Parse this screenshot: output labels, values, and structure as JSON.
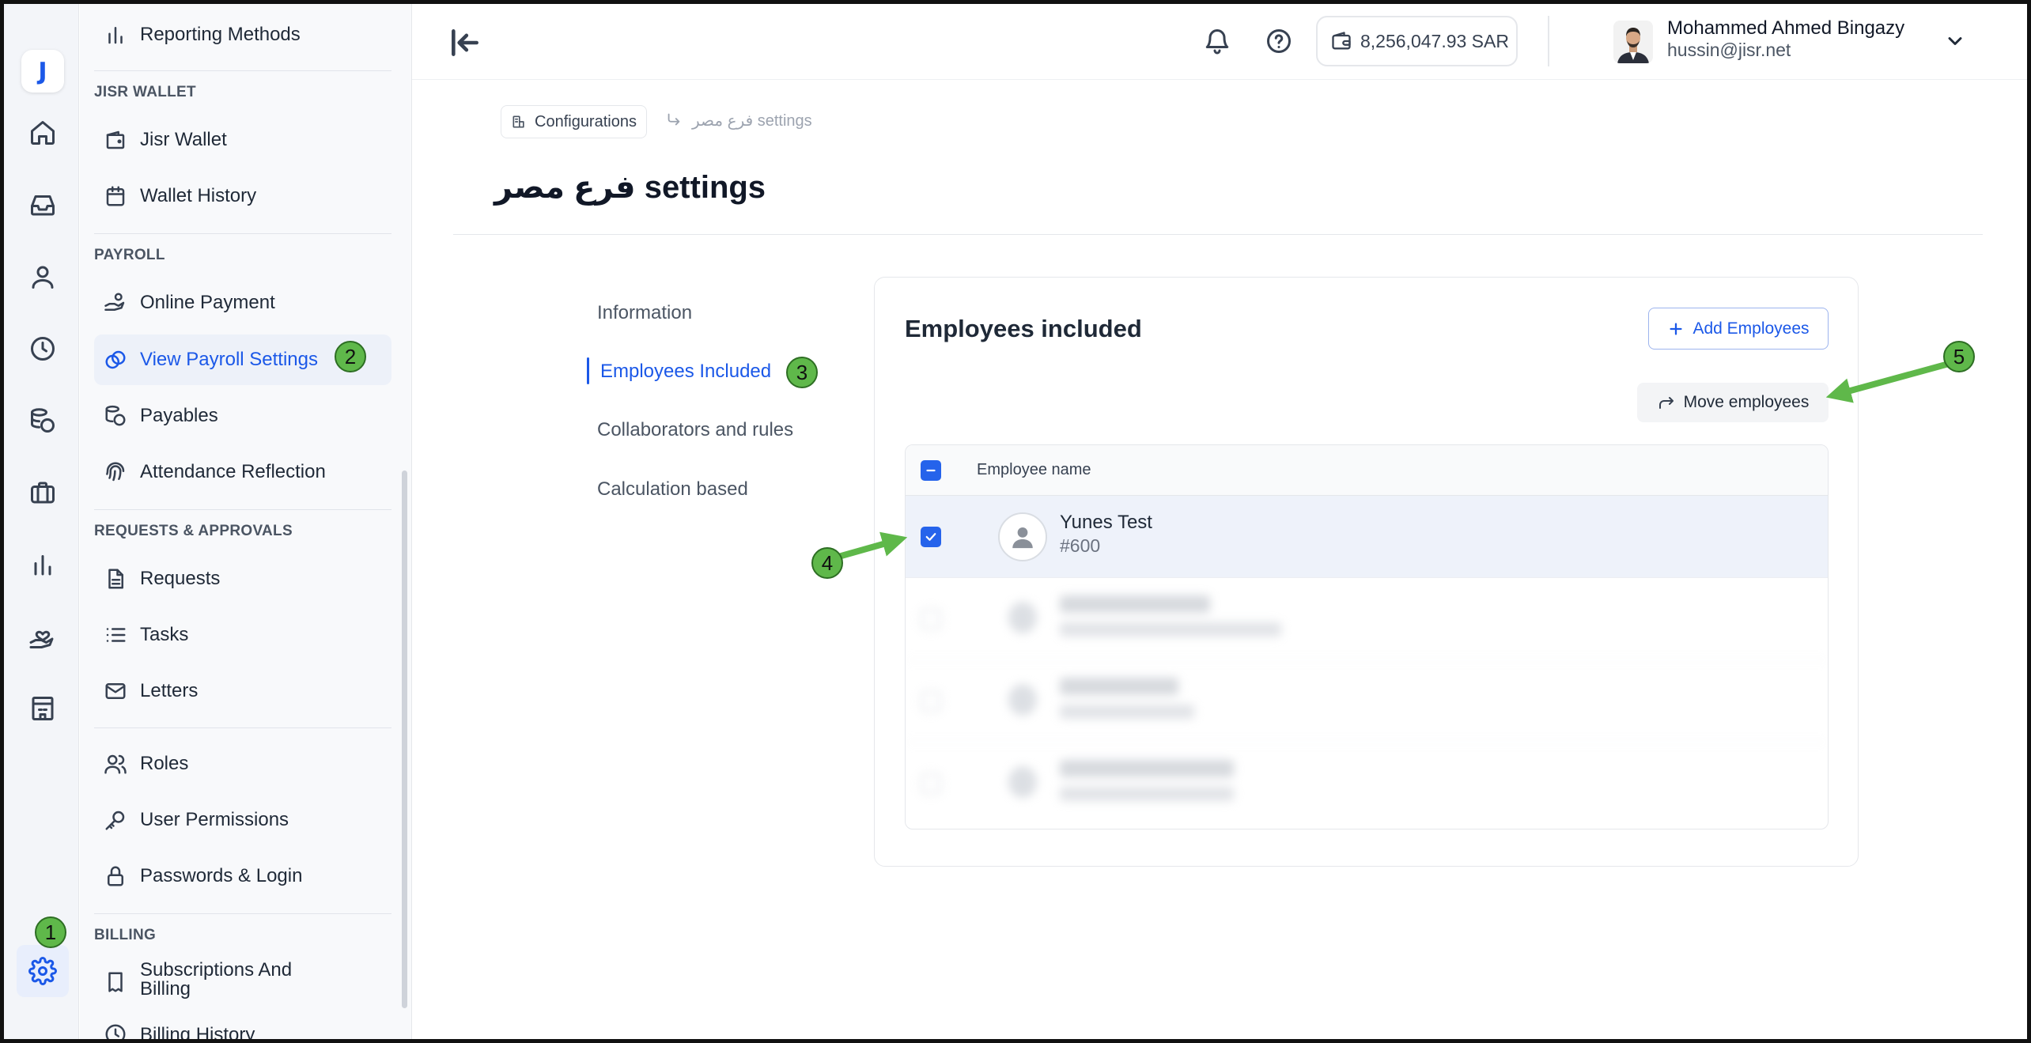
{
  "rail": {
    "logo": "J",
    "icons": [
      "home-icon",
      "inbox-icon",
      "user-icon",
      "clock-icon",
      "coins-icon",
      "briefcase-icon",
      "chart-icon",
      "hand-heart-icon",
      "building-icon",
      "gear-icon"
    ]
  },
  "sidebar": {
    "top_item": "Reporting Methods",
    "sections": {
      "wallet": "JISR WALLET",
      "payroll": "PAYROLL",
      "requests": "REQUESTS & APPROVALS",
      "billing": "BILLING"
    },
    "items": {
      "jisr_wallet": "Jisr Wallet",
      "wallet_history": "Wallet History",
      "online_payment": "Online Payment",
      "view_payroll_settings": "View Payroll Settings",
      "payables": "Payables",
      "attendance_reflection": "Attendance Reflection",
      "requests": "Requests",
      "tasks": "Tasks",
      "letters": "Letters",
      "roles": "Roles",
      "user_permissions": "User Permissions",
      "passwords_login": "Passwords & Login",
      "subscriptions_billing_line1": "Subscriptions And",
      "subscriptions_billing_line2": "Billing",
      "billing_history": "Billing History"
    }
  },
  "header": {
    "wallet_balance": "8,256,047.93 SAR",
    "user_name": "Mohammed Ahmed Bingazy",
    "user_email": "hussin@jisr.net"
  },
  "breadcrumb": {
    "parent": "Configurations",
    "current": "فرع مصر settings"
  },
  "page": {
    "title": "فرع مصر settings"
  },
  "settings_nav": {
    "information": "Information",
    "employees_included": "Employees Included",
    "collaborators": "Collaborators and rules",
    "calculation": "Calculation based"
  },
  "employees": {
    "title": "Employees included",
    "add_button": "Add Employees",
    "move_button": "Move employees",
    "column_name": "Employee name",
    "rows": [
      {
        "name": "Yunes Test",
        "id": "#600",
        "selected": true
      }
    ]
  },
  "annotations": [
    "1",
    "2",
    "3",
    "4",
    "5"
  ],
  "colors": {
    "accent": "#1b58e8",
    "annotation": "#5fb84a"
  }
}
